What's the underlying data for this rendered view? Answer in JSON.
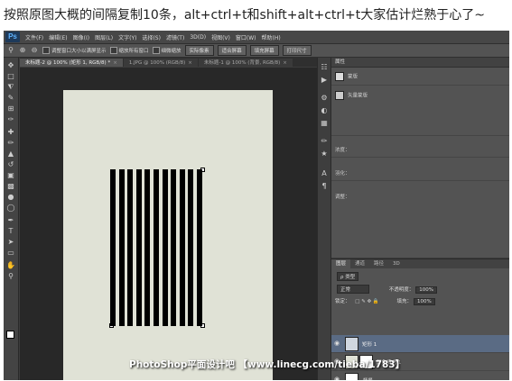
{
  "caption": "按照原图大概的间隔复制10条，alt+ctrl+t和shift+alt+ctrl+t大家估计烂熟于心了~",
  "app": {
    "logo": "Ps"
  },
  "menubar": [
    "文件(F)",
    "编辑(E)",
    "图像(I)",
    "图层(L)",
    "文字(Y)",
    "选择(S)",
    "滤镜(T)",
    "3D(D)",
    "视图(V)",
    "窗口(W)",
    "帮助(H)"
  ],
  "options": {
    "zoom_icons": [
      "zoom-tool-icon",
      "zoom-in-icon",
      "zoom-out-icon"
    ],
    "resize_label": "调整窗口大小以满屏显示",
    "zoom_all_label": "缩放所有窗口",
    "scrubby_label": "细微缩放",
    "buttons": [
      "实际像素",
      "适合屏幕",
      "填充屏幕",
      "打印尺寸"
    ]
  },
  "tabs": [
    {
      "label": "未标题-2 @ 100% (矩形 1, RGB/8) *",
      "close": "×"
    },
    {
      "label": "1.JPG @ 100% (RGB/8)",
      "close": "×"
    },
    {
      "label": "未标题-1 @ 100% (背景, RGB/8)",
      "close": "×"
    }
  ],
  "properties": {
    "title": "属性",
    "mask_label": "蒙版",
    "smart_label": "矢量蒙版",
    "density_label": "浓度：",
    "feather_label": "羽化：",
    "adjust_label": "调整："
  },
  "layers_panel": {
    "tabs": [
      "图层",
      "通道",
      "路径",
      "3D"
    ],
    "kind_label": "ρ 类型",
    "blend_mode": "正常",
    "opacity_label": "不透明度：",
    "opacity_value": "100%",
    "lock_label": "锁定：",
    "fill_label": "填充：",
    "fill_value": "100%",
    "layers": [
      {
        "name": "矩形 1",
        "selected": true
      },
      {
        "name": "颜色填充 1",
        "selected": false
      },
      {
        "name": "背景",
        "selected": false
      }
    ]
  },
  "canvas": {
    "stripe_count": 11,
    "stripe_color": "#000000",
    "doc_color": "#e0e2d6"
  },
  "watermark": "PhotoShop平面设计吧 【www.linecg.com/tieba/1783】"
}
